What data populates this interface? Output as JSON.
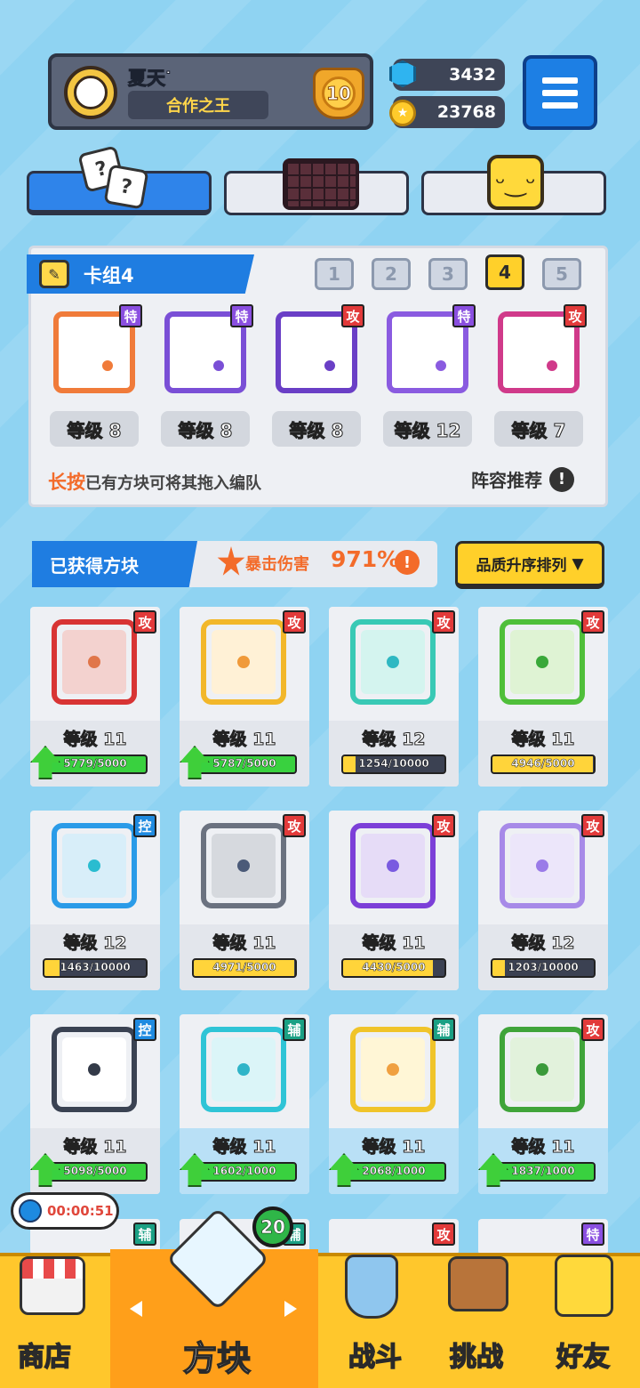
{
  "profile": {
    "username": "夏天ᐝ",
    "title": "合作之王",
    "rank": "10"
  },
  "currency": {
    "gems": "3432",
    "coins": "23768"
  },
  "icons": {
    "menu": "hamburger-icon",
    "gem": "gem-icon",
    "coin": "coin-icon"
  },
  "tabs": [
    {
      "name": "dice-tab",
      "icon": "dice-icon",
      "active": true
    },
    {
      "name": "board-tab",
      "icon": "board-icon",
      "active": false
    },
    {
      "name": "emote-tab",
      "icon": "smile-icon",
      "active": false
    }
  ],
  "deck": {
    "title": "卡组4",
    "numbers": [
      "1",
      "2",
      "3",
      "4",
      "5"
    ],
    "active_index": 3,
    "cards": [
      {
        "tag": "特",
        "tag_color": "#8a4fe0",
        "level": "等级 8",
        "color": "#f07b3a"
      },
      {
        "tag": "特",
        "tag_color": "#8a4fe0",
        "level": "等级 8",
        "color": "#7a4fd6"
      },
      {
        "tag": "攻",
        "tag_color": "#e23a3a",
        "level": "等级 8",
        "color": "#6a3fc6"
      },
      {
        "tag": "特",
        "tag_color": "#8a4fe0",
        "level": "等级 12",
        "color": "#8a5be0"
      },
      {
        "tag": "攻",
        "tag_color": "#e23a3a",
        "level": "等级 7",
        "color": "#d03a8a"
      }
    ],
    "hint_strong": "长按",
    "hint_rest": "已有方块可将其拖入编队",
    "lineup_label": "阵容推荐"
  },
  "obtained": {
    "title": "已获得方块",
    "crit_label": "暴击伤害",
    "crit_value": "971%",
    "sort_label": "品质升序排列"
  },
  "cards": [
    {
      "tag": "攻",
      "tag_class": "t-atk",
      "level": "等级 11",
      "progress": "5779/5000",
      "fill": 1.0,
      "bar_color": "#39d13f",
      "upgrade": true,
      "border": "#d83434",
      "inner": "#f3d2cf",
      "dot": "#e0764a",
      "blue": false
    },
    {
      "tag": "攻",
      "tag_class": "t-atk",
      "level": "等级 11",
      "progress": "5787/5000",
      "fill": 1.0,
      "bar_color": "#39d13f",
      "upgrade": true,
      "border": "#f2b72a",
      "inner": "#fff1d6",
      "dot": "#f09a3a",
      "blue": false
    },
    {
      "tag": "攻",
      "tag_class": "t-atk",
      "level": "等级 12",
      "progress": "1254/10000",
      "fill": 0.125,
      "bar_color": "#ffd43a",
      "upgrade": false,
      "border": "#39c9b5",
      "inner": "#d4f4ef",
      "dot": "#2fb8c2",
      "blue": false
    },
    {
      "tag": "攻",
      "tag_class": "t-atk",
      "level": "等级 11",
      "progress": "4946/5000",
      "fill": 0.99,
      "bar_color": "#ffd43a",
      "upgrade": false,
      "border": "#4fbf3a",
      "inner": "#dff3d4",
      "dot": "#3aa83a",
      "blue": false
    },
    {
      "tag": "控",
      "tag_class": "t-ctrl",
      "level": "等级 12",
      "progress": "1463/10000",
      "fill": 0.146,
      "bar_color": "#ffd43a",
      "upgrade": false,
      "border": "#2a9be8",
      "inner": "#d8eef9",
      "dot": "#2abcd0",
      "blue": false
    },
    {
      "tag": "攻",
      "tag_class": "t-atk",
      "level": "等级 11",
      "progress": "4971/5000",
      "fill": 0.994,
      "bar_color": "#ffd43a",
      "upgrade": false,
      "border": "#6b7280",
      "inner": "#d6d9de",
      "dot": "#4b5a78",
      "blue": false
    },
    {
      "tag": "攻",
      "tag_class": "t-atk",
      "level": "等级 11",
      "progress": "4430/5000",
      "fill": 0.886,
      "bar_color": "#ffd43a",
      "upgrade": false,
      "border": "#7c3fd8",
      "inner": "#e6dcf7",
      "dot": "#7a5be0",
      "blue": false
    },
    {
      "tag": "攻",
      "tag_class": "t-atk",
      "level": "等级 12",
      "progress": "1203/10000",
      "fill": 0.12,
      "bar_color": "#ffd43a",
      "upgrade": false,
      "border": "#a78ae8",
      "inner": "#ece6fa",
      "dot": "#9a7be8",
      "blue": false
    },
    {
      "tag": "控",
      "tag_class": "t-ctrl",
      "level": "等级 11",
      "progress": "5098/5000",
      "fill": 1.0,
      "bar_color": "#39d13f",
      "upgrade": true,
      "border": "#3a4252",
      "inner": "#ffffff",
      "dot": "#333a48",
      "blue": false
    },
    {
      "tag": "辅",
      "tag_class": "t-sup",
      "level": "等级 11",
      "progress": "1602/1000",
      "fill": 1.0,
      "bar_color": "#39d13f",
      "upgrade": true,
      "border": "#2fc4d6",
      "inner": "#dbf5f8",
      "dot": "#2fb4c8",
      "blue": true
    },
    {
      "tag": "辅",
      "tag_class": "t-sup",
      "level": "等级 11",
      "progress": "2068/1000",
      "fill": 1.0,
      "bar_color": "#39d13f",
      "upgrade": true,
      "border": "#f0c42a",
      "inner": "#fff6d6",
      "dot": "#f0a040",
      "blue": true
    },
    {
      "tag": "攻",
      "tag_class": "t-atk",
      "level": "等级 11",
      "progress": "1837/1000",
      "fill": 1.0,
      "bar_color": "#39d13f",
      "upgrade": true,
      "border": "#3fa43a",
      "inner": "#e2f2dc",
      "dot": "#3a9a3a",
      "blue": true
    }
  ],
  "partial_row": [
    {
      "tag": "辅",
      "tag_class": "t-sup"
    },
    {
      "tag": "辅",
      "tag_class": "t-sup"
    },
    {
      "tag": "攻",
      "tag_class": "t-atk"
    },
    {
      "tag": "特",
      "tag_class": "t-spc"
    }
  ],
  "timer": "00:00:51",
  "nav": {
    "shop": "商店",
    "blocks": "方块",
    "battle": "战斗",
    "challenge": "挑战",
    "friends": "好友",
    "badge": "20"
  }
}
